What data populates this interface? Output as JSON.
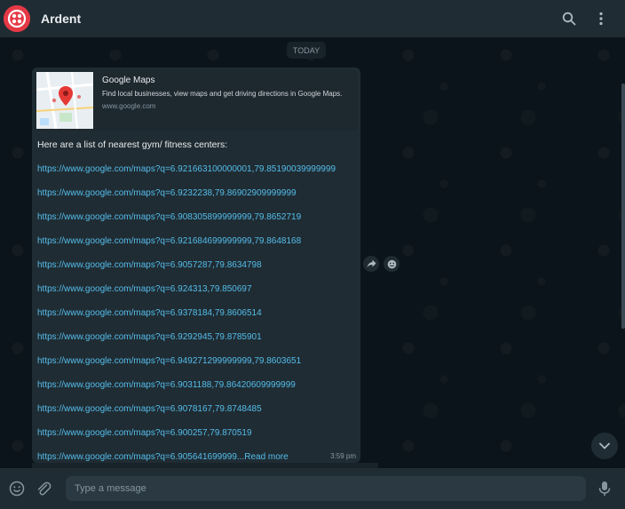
{
  "header": {
    "title": "Ardent",
    "logo_color": "#e53946"
  },
  "chat": {
    "date_chip": "TODAY",
    "message": {
      "preview": {
        "title": "Google Maps",
        "description": "Find local businesses, view maps and get driving directions in Google Maps.",
        "domain": "www.google.com"
      },
      "intro": "Here are a list of nearest gym/ fitness centers:",
      "links": [
        "https://www.google.com/maps?q=6.921663100000001,79.85190039999999",
        "https://www.google.com/maps?q=6.9232238,79.86902909999999",
        "https://www.google.com/maps?q=6.908305899999999,79.8652719",
        "https://www.google.com/maps?q=6.921684699999999,79.8648168",
        "https://www.google.com/maps?q=6.9057287,79.8634798",
        "https://www.google.com/maps?q=6.924313,79.850697",
        "https://www.google.com/maps?q=6.9378184,79.8606514",
        "https://www.google.com/maps?q=6.9292945,79.8785901",
        "https://www.google.com/maps?q=6.949271299999999,79.8603651",
        "https://www.google.com/maps?q=6.9031188,79.86420609999999",
        "https://www.google.com/maps?q=6.9078167,79.8748485",
        "https://www.google.com/maps?q=6.900257,79.870519"
      ],
      "last_link": "https://www.google.com/maps?q=6.905641699999...",
      "read_more": "Read more",
      "time": "3:59 pm"
    }
  },
  "composer": {
    "placeholder": "Type a message"
  },
  "colors": {
    "header_bg": "#202c33",
    "chat_bg": "#0b141a",
    "bubble_bg": "#202c33",
    "link": "#53bdeb"
  }
}
